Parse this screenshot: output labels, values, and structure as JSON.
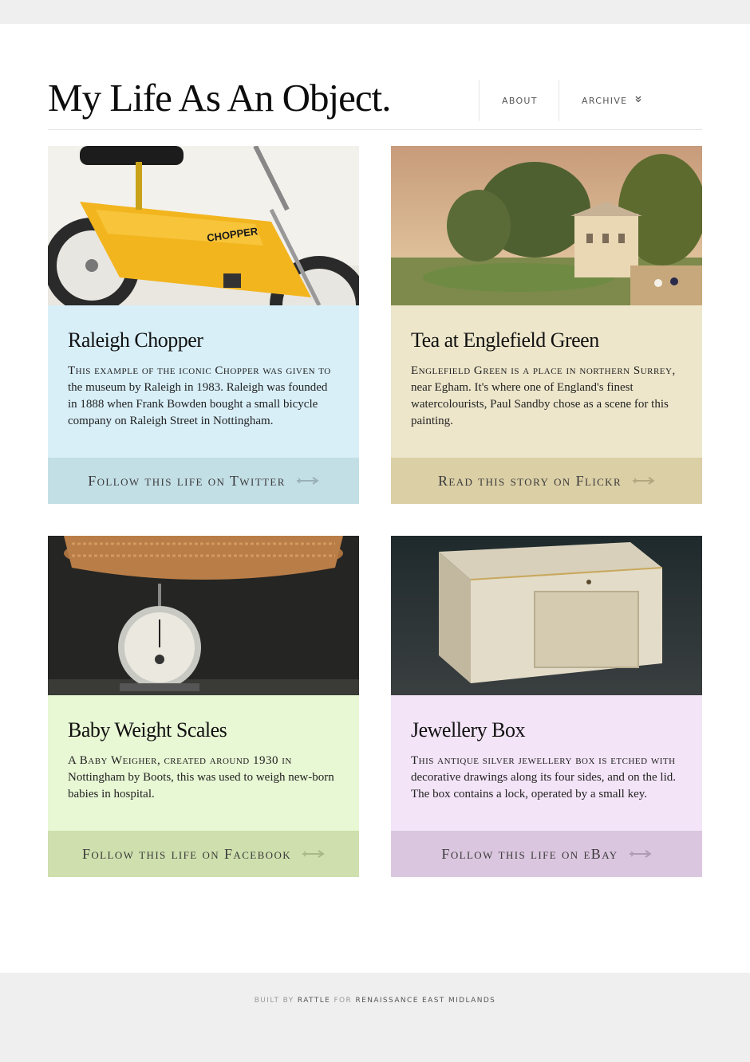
{
  "site": {
    "title": "My Life As An Object."
  },
  "nav": {
    "about": "ABOUT",
    "archive": "ARCHIVE"
  },
  "cards": [
    {
      "title": "Raleigh Chopper",
      "desc_lead": "This example of the iconic Chopper was given to",
      "desc_rest": "the museum by Raleigh in 1983. Raleigh was founded in 1888 when Frank Bowden bought a small bicycle company on Raleigh Street in Nottingham.",
      "cta": "Follow this life on Twitter",
      "body_color": "#d8eff8",
      "cta_color": "#c3dfe6"
    },
    {
      "title": "Tea at Englefield Green",
      "desc_lead": "Englefield Green is a place in northern Surrey,",
      "desc_rest": "near Egham. It's where one of England's finest watercolourists, Paul Sandby chose as a scene for this painting.",
      "cta": "Read this story on Flickr",
      "body_color": "#ede6cb",
      "cta_color": "#dbcfa6"
    },
    {
      "title": "Baby Weight Scales",
      "desc_lead": "A Baby Weigher, created around 1930 in",
      "desc_rest": "Nottingham by Boots, this was used to weigh new-born babies in hospital.",
      "cta": "Follow this life on Facebook",
      "body_color": "#e8f7d4",
      "cta_color": "#cfdfad"
    },
    {
      "title": "Jewellery Box",
      "desc_lead": "This antique silver jewellery box is etched with",
      "desc_rest": "decorative drawings along its four sides, and on the lid. The box contains a lock, operated by a small key.",
      "cta": "Follow this life on eBay",
      "body_color": "#f3e4f7",
      "cta_color": "#dbc6df"
    }
  ],
  "footer": {
    "built_by": "BUILT BY",
    "rattle": "RATTLE",
    "for": "FOR",
    "client": "RENAISSANCE EAST MIDLANDS"
  }
}
